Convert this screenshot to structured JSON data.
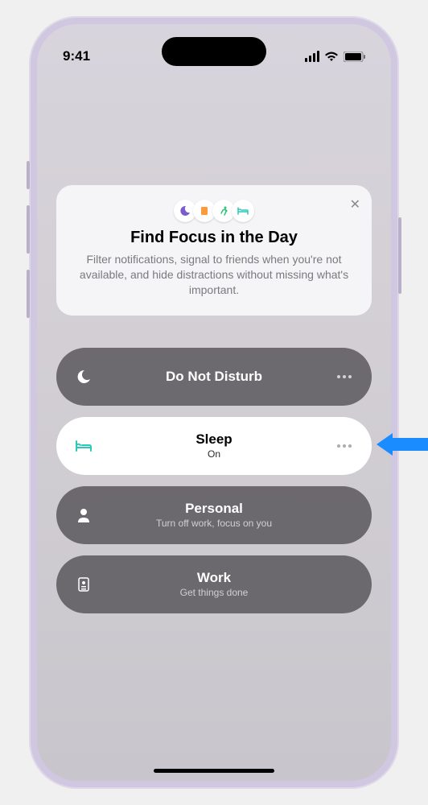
{
  "status": {
    "time": "9:41"
  },
  "promo": {
    "title": "Find Focus in the Day",
    "description": "Filter notifications, signal to friends when you're not available, and hide distractions without missing what's important."
  },
  "focus_items": [
    {
      "icon": "moon",
      "label": "Do Not Disturb",
      "sub": "",
      "active": false
    },
    {
      "icon": "bed",
      "label": "Sleep",
      "sub": "On",
      "active": true
    },
    {
      "icon": "person",
      "label": "Personal",
      "sub": "Turn off work, focus on you",
      "active": false
    },
    {
      "icon": "badge",
      "label": "Work",
      "sub": "Get things done",
      "active": false
    }
  ]
}
